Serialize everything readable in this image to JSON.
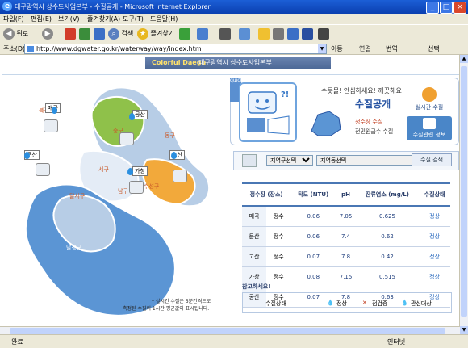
{
  "window": {
    "title": "대구광역시 상수도사업본부 - 수질공개 - Microsoft Internet Explorer",
    "buttons": [
      "_",
      "□",
      "×"
    ]
  },
  "menubar": [
    "파일(F)",
    "편집(E)",
    "보기(V)",
    "즐겨찾기(A)",
    "도구(T)",
    "도움말(H)"
  ],
  "toolbar": {
    "back": "뒤로",
    "search": "검색",
    "favorites": "즐겨찾기"
  },
  "address": {
    "label": "주소(D)",
    "url": "http://www.dgwater.go.kr/waterway/way/index.htm",
    "go": "이동",
    "links": "연결",
    "translate": "번역",
    "select": "선택"
  },
  "banner": {
    "logo": "Colorful Daegu",
    "subtitle": "대구광역시 상수도사업본부"
  },
  "map": {
    "regions": [
      "북구",
      "동구",
      "서구",
      "중구",
      "남구",
      "수성구",
      "달서구",
      "달성군"
    ],
    "plants": [
      "매곡",
      "공산",
      "문산",
      "가창",
      "고산"
    ],
    "notes": [
      "* 실시간 수질은 5분간격으로",
      "측정된 수질의 1시간 평균값이 표시됩니다."
    ]
  },
  "info": {
    "tab": "quick",
    "title_small": "수돗물! 안심하세요! 깨끗해요!",
    "title_big": "수질공개",
    "option1": "정수장 수질",
    "option2": "전민원급수 수질",
    "btn1": "실시간 수질",
    "btn2": "수질관련 정보"
  },
  "search": {
    "district_select": "지역구선택",
    "dong_select": "지역동선택",
    "button": "수질 검색"
  },
  "table": {
    "headers": [
      "정수장 (장소)",
      "탁도 (NTU)",
      "pH",
      "잔류염소 (mg/L)",
      "수질상태"
    ],
    "rows": [
      {
        "plant": "매곡",
        "type": "정수",
        "turbidity": "0.06",
        "ph": "7.05",
        "chlorine": "0.625",
        "status": "정상"
      },
      {
        "plant": "문산",
        "type": "정수",
        "turbidity": "0.06",
        "ph": "7.4",
        "chlorine": "0.62",
        "status": "정상"
      },
      {
        "plant": "고산",
        "type": "정수",
        "turbidity": "0.07",
        "ph": "7.8",
        "chlorine": "0.42",
        "status": "정상"
      },
      {
        "plant": "가창",
        "type": "정수",
        "turbidity": "0.08",
        "ph": "7.15",
        "chlorine": "0.515",
        "status": "정상"
      },
      {
        "plant": "공산",
        "type": "정수",
        "turbidity": "0.07",
        "ph": "7.8",
        "chlorine": "0.63",
        "status": "정상"
      }
    ]
  },
  "reference": {
    "title": "참고하세요!",
    "legend_title": "수질상태",
    "legend": [
      "정상",
      "점검중",
      "관심대상"
    ]
  },
  "status": {
    "text": "완료",
    "zone": "인터넷"
  },
  "colors": {
    "titlebar": "#0a3fb0",
    "accent": "#2a56a4",
    "map_blue": "#5b95d4",
    "map_green": "#8fc14a",
    "map_orange": "#f2a93b"
  }
}
